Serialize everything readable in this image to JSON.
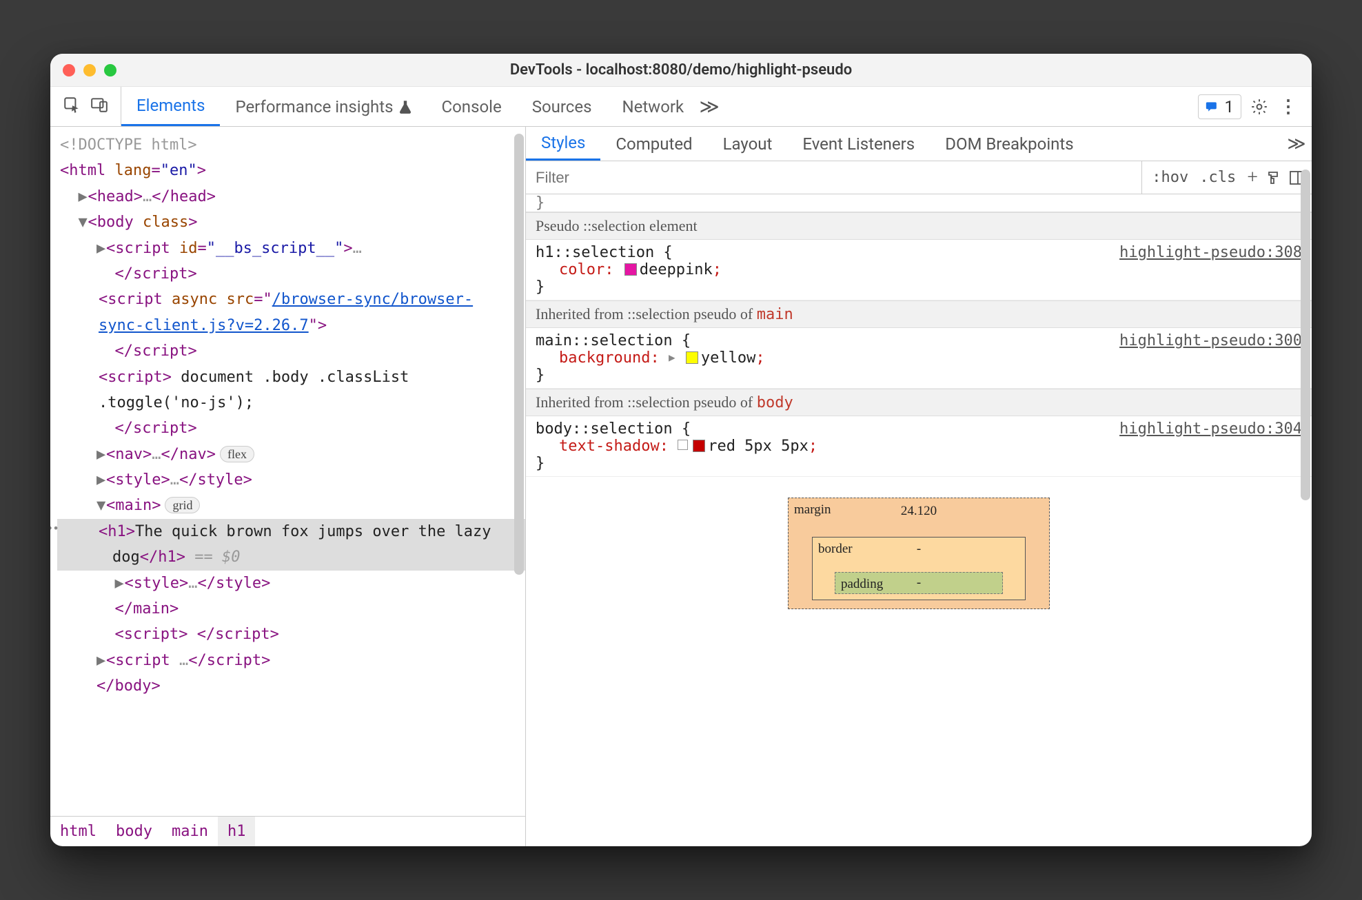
{
  "window": {
    "title": "DevTools - localhost:8080/demo/highlight-pseudo"
  },
  "main_tabs": {
    "elements": "Elements",
    "performance_insights": "Performance insights",
    "console": "Console",
    "sources": "Sources",
    "network": "Network",
    "more": "≫",
    "issues_count": "1"
  },
  "dom": {
    "doctype": "<!DOCTYPE html>",
    "html_open": "<html ",
    "html_lang_attr": "lang",
    "html_lang_val": "\"en\"",
    "html_close": ">",
    "head": "<head>",
    "head_ell": "…",
    "head_end": "</head>",
    "body": "<body ",
    "body_class": "class",
    "body_gt": ">",
    "bs_open": "<script ",
    "bs_id_attr": "id",
    "bs_id_val": "\"__bs_script__\"",
    "bs_gt": ">",
    "bs_ell": "…",
    "endscript": "</script>",
    "sync_open": "<script ",
    "sync_async": "async ",
    "sync_src_attr": "src",
    "sync_eq": "=\"",
    "sync_link": "/browser-sync/browser-sync-client.js?v=2.26.7",
    "sync_end": "\">",
    "inline_open": "<script>",
    "inline_txt": " document .body .classList .toggle('no-js');",
    "nav_open": "<nav>",
    "nav_ell": "…",
    "nav_end": "</nav>",
    "nav_badge": "flex",
    "style_open": "<style>",
    "style_ell": "…",
    "style_end": "</style>",
    "main_open": "<main>",
    "main_badge": "grid",
    "h1_open": "<h1>",
    "h1_text": "The quick brown fox jumps over the lazy dog",
    "h1_close": "</h1>",
    "h1_suffix": " == $0",
    "main_end": "</main>",
    "empty_script": "<script> </script>",
    "body_end": "</body>"
  },
  "breadcrumb": [
    "html",
    "body",
    "main",
    "h1"
  ],
  "sub_tabs": {
    "styles": "Styles",
    "computed": "Computed",
    "layout": "Layout",
    "event_listeners": "Event Listeners",
    "dom_breakpoints": "DOM Breakpoints",
    "more": "≫"
  },
  "filter": {
    "placeholder": "Filter",
    "hov": ":hov",
    "cls": ".cls"
  },
  "styles": {
    "clip_brace": "}",
    "head1": "Pseudo ::selection element",
    "rule1_sel": "h1::selection {",
    "rule1_src": "highlight-pseudo:308",
    "rule1_prop": "color",
    "rule1_val": "deeppink",
    "rule1_swatch": "#e516a3",
    "head2_pre": "Inherited from ::selection pseudo of ",
    "head2_el": "main",
    "rule2_sel": "main::selection {",
    "rule2_src": "highlight-pseudo:300",
    "rule2_prop": "background",
    "rule2_val": "yellow",
    "rule2_swatch": "#fdfd00",
    "head3_pre": "Inherited from ::selection pseudo of ",
    "head3_el": "body",
    "rule3_sel": "body::selection {",
    "rule3_src": "highlight-pseudo:304",
    "rule3_prop": "text-shadow",
    "rule3_val": "red 5px 5px",
    "rule3_swatch": "#c40000"
  },
  "boxmodel": {
    "margin_label": "margin",
    "margin_top": "24.120",
    "border_label": "border",
    "border_top": "-",
    "padding_label": "padding",
    "padding_top": "-"
  }
}
